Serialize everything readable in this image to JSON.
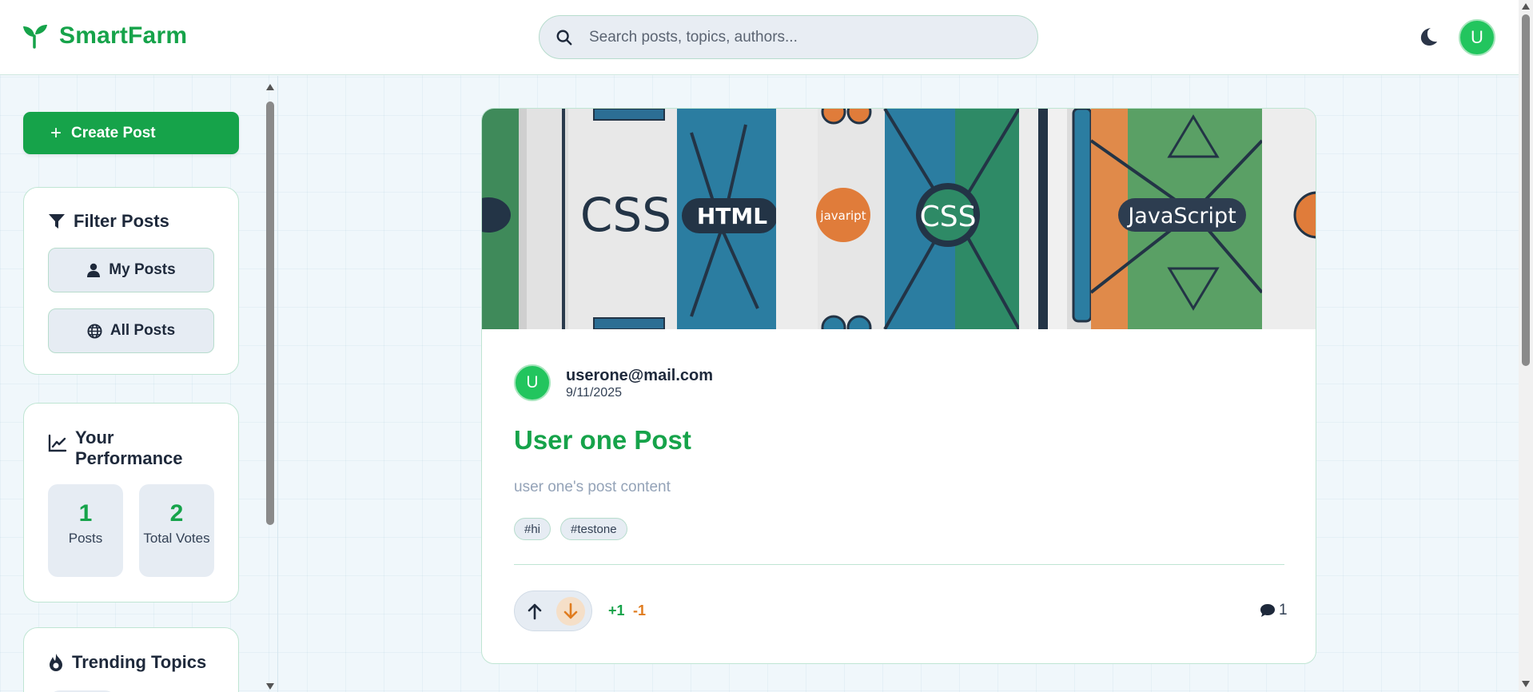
{
  "header": {
    "brand": "SmartFarm",
    "search_placeholder": "Search posts, topics, authors...",
    "user_initial": "U"
  },
  "sidebar": {
    "create_label": "Create Post",
    "filter_title": "Filter Posts",
    "my_posts_label": "My Posts",
    "all_posts_label": "All Posts",
    "performance_title": "Your Performance",
    "stats": {
      "posts_value": "1",
      "posts_label": "Posts",
      "votes_value": "2",
      "votes_label": "Total Votes"
    },
    "trending_title": "Trending Topics"
  },
  "post": {
    "author_initial": "U",
    "author_email": "userone@mail.com",
    "date": "9/11/2025",
    "title": "User one Post",
    "content": "user one's post content",
    "tags": [
      "#hi",
      "#testone"
    ],
    "upvotes": "+1",
    "downvotes": "-1",
    "comments": "1",
    "banner_labels": {
      "css": "CSS",
      "html": "HTML",
      "javascript_badge": "javaript",
      "javascript": "JavaScript"
    }
  },
  "colors": {
    "brand": "#16a34a",
    "downvote": "#e07c1f",
    "avatar": "#22c55e"
  },
  "icons": [
    "sprout-icon",
    "search-icon",
    "moon-icon",
    "plus-icon",
    "filter-icon",
    "user-icon",
    "globe-icon",
    "chart-line-icon",
    "flame-icon",
    "arrow-up-icon",
    "arrow-down-icon",
    "comment-icon"
  ]
}
